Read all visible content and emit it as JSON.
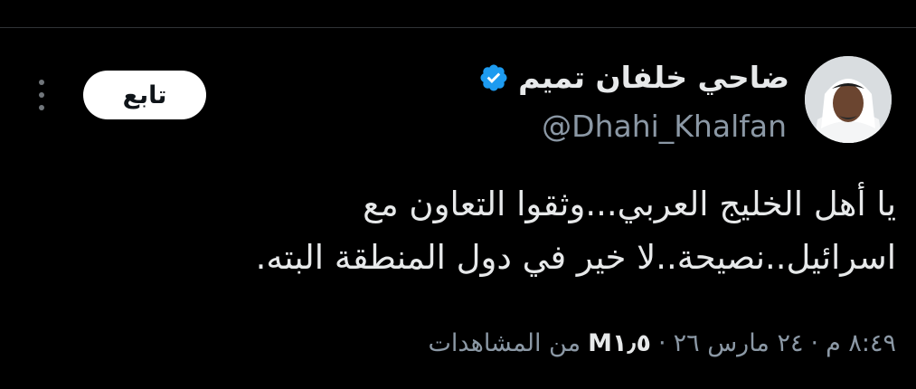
{
  "tweet": {
    "author": {
      "display_name": "ضاحي خلفان تميم",
      "handle": "@Dhahi_Khalfan",
      "verified": true,
      "verified_color": "#1d9bf0"
    },
    "follow_label": "تابع",
    "text_lines": [
      "يا أهل الخليج العربي...وثقوا التعاون مع",
      "اسرائيل..نصيحة..لا خير في دول المنطقة البته."
    ],
    "meta": {
      "time": "٨:٤٩ م",
      "separator": "·",
      "date": "٢٤ مارس ٢٦",
      "views_count": "M١٫٥",
      "views_label": "من المشاهدات"
    }
  },
  "colors": {
    "background": "#000000",
    "text_primary": "#e7e9ea",
    "text_secondary": "#8b98a5",
    "follow_bg": "#ffffff"
  },
  "icons": {
    "verified": "verified-badge-icon",
    "more": "more-vertical-icon"
  }
}
